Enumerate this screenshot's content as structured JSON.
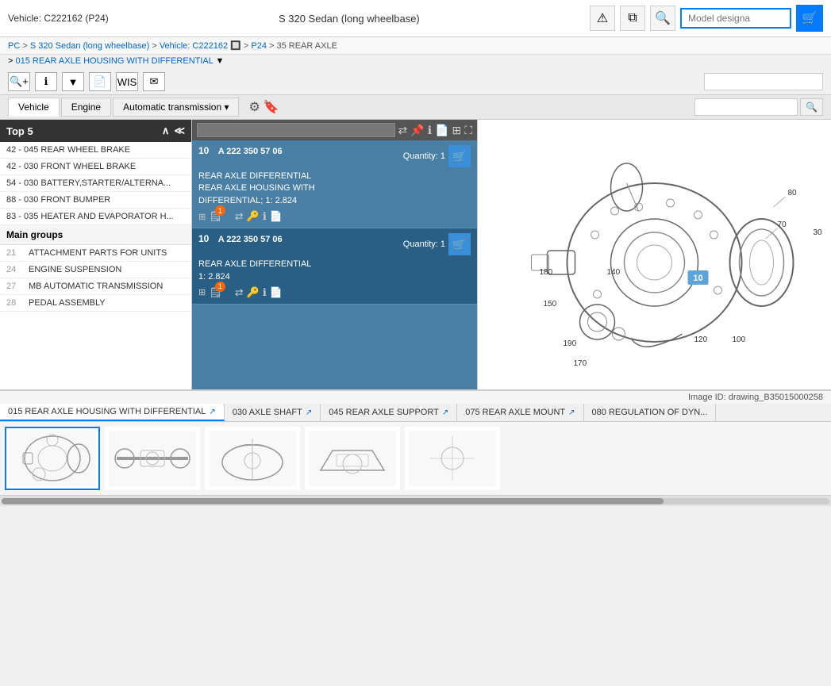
{
  "header": {
    "vehicle_left": "Vehicle: C222162 (P24)",
    "vehicle_center": "S 320 Sedan (long wheelbase)",
    "model_placeholder": "Model designa",
    "warning_icon": "⚠",
    "copy_icon": "⧉",
    "search_icon": "🔍",
    "cart_icon": "🛒"
  },
  "breadcrumb": {
    "items": [
      "PC",
      "S 320 Sedan (long wheelbase)",
      "Vehicle: C222162",
      "P24",
      "35 REAR AXLE"
    ],
    "sub": "015 REAR AXLE HOUSING WITH DIFFERENTIAL"
  },
  "toolbar2": {
    "zoom_in": "+",
    "info": "i",
    "filter": "▼",
    "doc": "📄",
    "wis": "WIS",
    "mail": "✉",
    "search_placeholder": ""
  },
  "tabs": {
    "items": [
      "Vehicle",
      "Engine",
      "Automatic transmission"
    ]
  },
  "sidebar": {
    "title": "Top 5",
    "items": [
      "42 - 045 REAR WHEEL BRAKE",
      "42 - 030 FRONT WHEEL BRAKE",
      "54 - 030 BATTERY,STARTER/ALTERNA...",
      "88 - 030 FRONT BUMPER",
      "83 - 035 HEATER AND EVAPORATOR H..."
    ],
    "section_title": "Main groups",
    "groups": [
      {
        "num": "21",
        "label": "ATTACHMENT PARTS FOR UNITS"
      },
      {
        "num": "24",
        "label": "ENGINE SUSPENSION"
      },
      {
        "num": "27",
        "label": "MB AUTOMATIC TRANSMISSION"
      },
      {
        "num": "28",
        "label": "PEDAL ASSEMBLY"
      }
    ]
  },
  "parts": [
    {
      "pos": "10",
      "ref": "A 222 350 57 06",
      "qty_label": "Quantity:",
      "qty": "1",
      "desc1": "REAR AXLE DIFFERENTIAL",
      "desc2": "REAR AXLE HOUSING WITH",
      "desc3": "DIFFERENTIAL; 1: 2.824",
      "badge": "1"
    },
    {
      "pos": "10",
      "ref": "A 222 350 57 06",
      "qty_label": "Quantity:",
      "qty": "1",
      "desc1": "REAR AXLE DIFFERENTIAL",
      "desc2": "1: 2.824",
      "badge": "1"
    }
  ],
  "image_id": "Image ID: drawing_B35015000258",
  "diagram_numbers": [
    "80",
    "30",
    "70",
    "10",
    "180",
    "140",
    "150",
    "120",
    "100",
    "190",
    "170"
  ],
  "thumbnail_tabs": [
    {
      "label": "015 REAR AXLE HOUSING WITH DIFFERENTIAL",
      "active": true
    },
    {
      "label": "030 AXLE SHAFT",
      "active": false
    },
    {
      "label": "045 REAR AXLE SUPPORT",
      "active": false
    },
    {
      "label": "075 REAR AXLE MOUNT",
      "active": false
    },
    {
      "label": "080 REGULATION OF DYN...",
      "active": false
    }
  ]
}
